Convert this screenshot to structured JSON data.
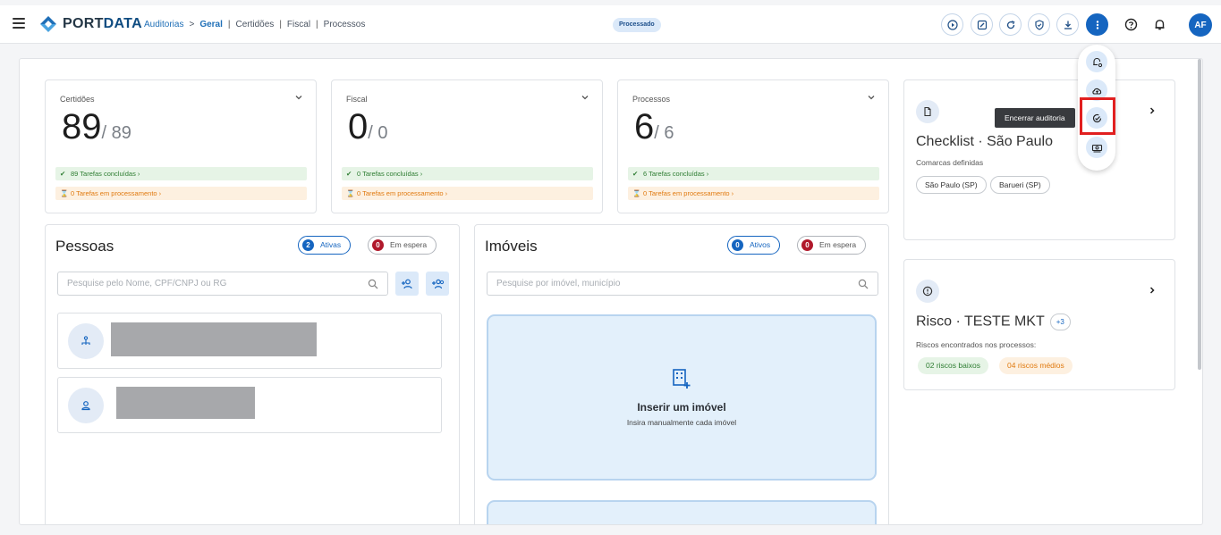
{
  "header": {
    "logo_text_a": "PORT",
    "logo_text_b": "DATA",
    "breadcrumb": {
      "root": "Auditorias",
      "arrow": ">",
      "current": "Geral",
      "items": [
        "Certidões",
        "Fiscal",
        "Processos"
      ],
      "separator": "|"
    },
    "status": "Processado",
    "avatar_initials": "AF",
    "toolbar_icons": [
      "play-icon",
      "edit-note-icon",
      "refresh-icon",
      "shield-check-icon",
      "download-icon",
      "more-vertical-icon",
      "help-icon",
      "bell-icon"
    ]
  },
  "stats": [
    {
      "label": "Certidões",
      "value": "89",
      "total": "/ 89",
      "done": "89 Tarefas concluídas",
      "processing": "0 Tarefas em processamento"
    },
    {
      "label": "Fiscal",
      "value": "0",
      "total": "/ 0",
      "done": "0 Tarefas concluídas",
      "processing": "0 Tarefas em processamento"
    },
    {
      "label": "Processos",
      "value": "6",
      "total": "/ 6",
      "done": "6 Tarefas concluídas",
      "processing": "0 Tarefas em processamento"
    }
  ],
  "pessoas": {
    "title": "Pessoas",
    "active_count": "2",
    "active_label": "Ativas",
    "wait_count": "0",
    "wait_label": "Em espera",
    "search_placeholder": "Pesquise pelo Nome, CPF/CNPJ ou RG"
  },
  "imoveis": {
    "title": "Imóveis",
    "active_count": "0",
    "active_label": "Ativos",
    "wait_count": "0",
    "wait_label": "Em espera",
    "search_placeholder": "Pesquise por imóvel, município",
    "add_title": "Inserir um imóvel",
    "add_subtitle": "Insira manualmente cada imóvel"
  },
  "checklist": {
    "title": "Checklist · São Paulo",
    "subtitle": "Comarcas definidas",
    "chips": [
      "São Paulo (SP)",
      "Barueri (SP)"
    ]
  },
  "risco": {
    "title": "Risco · TESTE MKT",
    "extra": "+3",
    "subtitle": "Riscos encontrados nos processos:",
    "low": "02 riscos baixos",
    "medium": "04 riscos médios"
  },
  "floating_menu": {
    "tooltip": "Encerrar auditoria",
    "icons": [
      "bell-settings-icon",
      "cloud-upload-icon",
      "close-audit-icon",
      "money-icon"
    ]
  },
  "colors": {
    "primary": "#1565c0",
    "success": "#2e7d32",
    "warning": "#e07a10",
    "danger": "#b0182b",
    "highlight": "#e11f1f"
  }
}
